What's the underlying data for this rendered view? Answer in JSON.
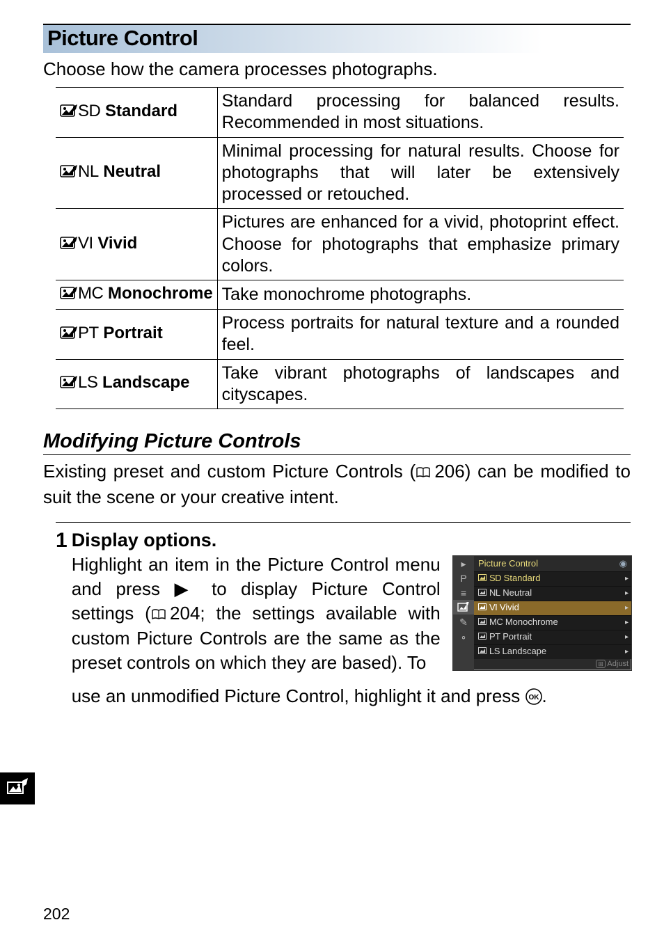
{
  "section_title": "Picture Control",
  "intro": "Choose how the camera processes photographs.",
  "rows": [
    {
      "code": "SD",
      "name": "Standard",
      "desc": "Standard processing for balanced results. Recommended in most situations."
    },
    {
      "code": "NL",
      "name": "Neutral",
      "desc": "Minimal processing for natural results. Choose for photographs that will later be extensively processed or retouched."
    },
    {
      "code": "VI",
      "name": "Vivid",
      "desc": "Pictures are enhanced for a vivid, photoprint effect. Choose for photographs that emphasize primary colors."
    },
    {
      "code": "MC",
      "name": "Monochrome",
      "desc": "Take monochrome photographs."
    },
    {
      "code": "PT",
      "name": "Portrait",
      "desc": "Process portraits for natural texture and a rounded feel."
    },
    {
      "code": "LS",
      "name": "Landscape",
      "desc": "Take vibrant photographs of landscapes and cityscapes."
    }
  ],
  "subhead": "Modifying Picture Controls",
  "intro2_a": "Existing preset and custom Picture Controls (",
  "intro2_ref": "206",
  "intro2_b": ") can be modified to suit the scene or your creative intent.",
  "step": {
    "num": "1",
    "title": "Display options.",
    "body_a": "Highlight an item in the Picture Control menu and press ",
    "body_b": " to display Picture Control settings (",
    "body_ref": "204",
    "body_c": "; the settings available with custom Picture Controls are the same as the preset controls on which they are based). To",
    "after_a": "use an unmodified Picture Control, highlight it and press ",
    "after_b": "."
  },
  "lcd": {
    "title": "Picture Control",
    "items": [
      {
        "code": "SD",
        "name": "Standard",
        "sel": false,
        "hl": true
      },
      {
        "code": "NL",
        "name": "Neutral",
        "sel": false,
        "hl": false
      },
      {
        "code": "VI",
        "name": "Vivid",
        "sel": true,
        "hl": false
      },
      {
        "code": "MC",
        "name": "Monochrome",
        "sel": false,
        "hl": false
      },
      {
        "code": "PT",
        "name": "Portrait",
        "sel": false,
        "hl": false
      },
      {
        "code": "LS",
        "name": "Landscape",
        "sel": false,
        "hl": false
      }
    ],
    "foot": "Adjust"
  },
  "left_icons": [
    "▸",
    "P",
    "≡",
    "⚙",
    "✎",
    "∘"
  ],
  "page_number": "202"
}
